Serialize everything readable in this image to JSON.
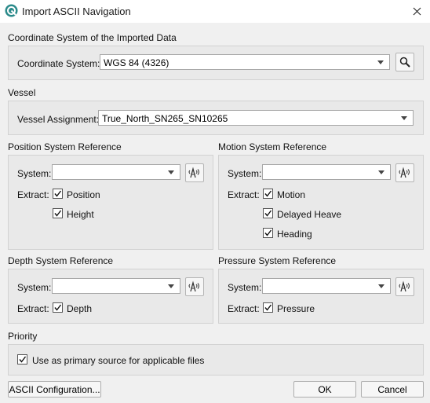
{
  "window": {
    "title": "Import ASCII Navigation"
  },
  "coord": {
    "section_title": "Coordinate System of the Imported Data",
    "label": "Coordinate System:",
    "value": "WGS 84 (4326)"
  },
  "vessel": {
    "section_title": "Vessel",
    "label": "Vessel Assignment:",
    "value": "True_North_SN265_SN10265"
  },
  "position": {
    "section_title": "Position System Reference",
    "system_label": "System:",
    "system_value": "",
    "extract_label": "Extract:",
    "options": [
      {
        "label": "Position",
        "checked": true
      },
      {
        "label": "Height",
        "checked": true
      }
    ]
  },
  "motion": {
    "section_title": "Motion System Reference",
    "system_label": "System:",
    "system_value": "",
    "extract_label": "Extract:",
    "options": [
      {
        "label": "Motion",
        "checked": true
      },
      {
        "label": "Delayed Heave",
        "checked": true
      },
      {
        "label": "Heading",
        "checked": true
      }
    ]
  },
  "depth": {
    "section_title": "Depth System Reference",
    "system_label": "System:",
    "system_value": "",
    "extract_label": "Extract:",
    "options": [
      {
        "label": "Depth",
        "checked": true
      }
    ]
  },
  "pressure": {
    "section_title": "Pressure System Reference",
    "system_label": "System:",
    "system_value": "",
    "extract_label": "Extract:",
    "options": [
      {
        "label": "Pressure",
        "checked": true
      }
    ]
  },
  "priority": {
    "section_title": "Priority",
    "option": {
      "label": "Use as primary source for applicable files",
      "checked": true
    }
  },
  "buttons": {
    "ascii_config": "ASCII Configuration...",
    "ok": "OK",
    "cancel": "Cancel"
  },
  "icons": {
    "app": "app-logo-icon",
    "close": "close-icon",
    "search": "search-icon",
    "sensor": "sensor-signal-icon",
    "check": "checkmark-icon"
  },
  "colors": {
    "app_icon": "#2a8a8a"
  }
}
